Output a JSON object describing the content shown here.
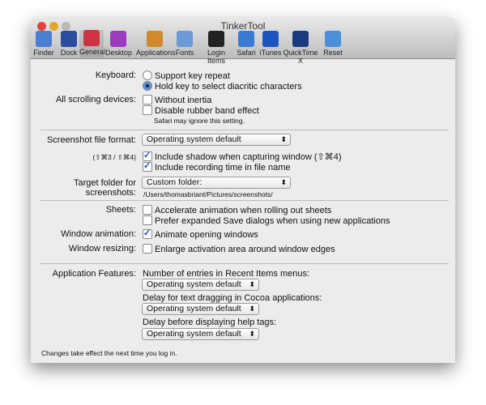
{
  "window": {
    "title": "TinkerTool"
  },
  "toolbar": [
    {
      "label": "Finder",
      "color": "#4a7fd1"
    },
    {
      "label": "Dock",
      "color": "#2b4d9e"
    },
    {
      "label": "General",
      "color": "#cc3344"
    },
    {
      "label": "Desktop",
      "color": "#9a3dbd"
    },
    {
      "label": "Applications",
      "color": "#d08a2a"
    },
    {
      "label": "Fonts",
      "color": "#6a9ad8"
    },
    {
      "label": "Login Items",
      "color": "#222222"
    },
    {
      "label": "Safari",
      "color": "#3a7ad0"
    },
    {
      "label": "iTunes",
      "color": "#1d55c0"
    },
    {
      "label": "QuickTime X",
      "color": "#1a3a80"
    },
    {
      "label": "Reset",
      "color": "#4a8fd8"
    }
  ],
  "keyboard": {
    "label": "Keyboard:",
    "opt1": "Support key repeat",
    "opt2": "Hold key to select diacritic characters"
  },
  "scrolling": {
    "label": "All scrolling devices:",
    "opt1": "Without inertia",
    "opt2": "Disable rubber band effect",
    "note": "Safari may ignore this setting."
  },
  "screenshot": {
    "label": "Screenshot file format:",
    "value": "Operating system default",
    "shortcut": "(⇧⌘3 / ⇧⌘4)",
    "shadow": "Include shadow when capturing window (⇧⌘4)",
    "time": "Include recording time in file name",
    "folder_label1": "Target folder for",
    "folder_label2": "screenshots:",
    "folder_value": "Custom folder:",
    "folder_path": "/Users/thomasbriant/Pictures/screenshots/"
  },
  "sheets": {
    "label": "Sheets:",
    "opt1": "Accelerate animation when rolling out sheets",
    "opt2": "Prefer expanded Save dialogs when using new applications"
  },
  "anim": {
    "label": "Window animation:",
    "opt": "Animate opening windows"
  },
  "resize": {
    "label": "Window resizing:",
    "opt": "Enlarge activation area around window edges"
  },
  "app": {
    "label": "Application Features:",
    "q1": "Number of entries in Recent Items menus:",
    "v1": "Operating system default",
    "q2": "Delay for text dragging in Cocoa applications:",
    "v2": "Operating system default",
    "q3": "Delay before displaying help tags:",
    "v3": "Operating system default"
  },
  "footer": "Changes take effect the next time you log in."
}
